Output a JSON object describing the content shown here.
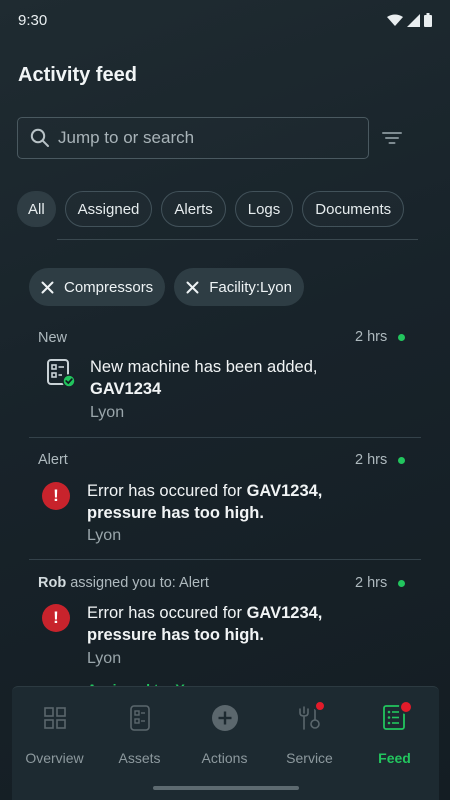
{
  "status": {
    "time": "9:30"
  },
  "page": {
    "title": "Activity feed"
  },
  "search": {
    "placeholder": "Jump to or search"
  },
  "chips": [
    {
      "label": "All",
      "active": true
    },
    {
      "label": "Assigned",
      "active": false
    },
    {
      "label": "Alerts",
      "active": false
    },
    {
      "label": "Logs",
      "active": false
    },
    {
      "label": "Documents",
      "active": false
    }
  ],
  "filter_tags": [
    {
      "label": "Compressors"
    },
    {
      "label": "Facility:Lyon"
    }
  ],
  "feed": [
    {
      "category": "New",
      "time": "2 hrs",
      "text": "New machine has been added,",
      "text_bold": "GAV1234",
      "location": "Lyon",
      "icon": "machine-added-icon"
    },
    {
      "category": "Alert",
      "time": "2 hrs",
      "text": "Error has occured for ",
      "text_bold": "GAV1234,",
      "text_bold_2": "pressure has too high.",
      "location": "Lyon",
      "icon": "alert-icon"
    },
    {
      "actor": "Rob",
      "category": "assigned you to: Alert",
      "time": "2 hrs",
      "text": "Error has occured for ",
      "text_bold": "GAV1234,",
      "text_bold_2": "pressure has too high.",
      "location": "Lyon",
      "assigned": "Assigned to: You",
      "icon": "alert-icon"
    }
  ],
  "nav": [
    {
      "label": "Overview",
      "icon": "grid-icon",
      "active": false
    },
    {
      "label": "Assets",
      "icon": "assets-icon",
      "active": false
    },
    {
      "label": "Actions",
      "icon": "plus-circle-icon",
      "active": false
    },
    {
      "label": "Service",
      "icon": "wrench-icon",
      "active": false,
      "badge": true
    },
    {
      "label": "Feed",
      "icon": "feed-icon",
      "active": true,
      "badge": true
    }
  ],
  "colors": {
    "accent": "#22c55e",
    "alert": "#c8232c",
    "background": "#18232a"
  }
}
